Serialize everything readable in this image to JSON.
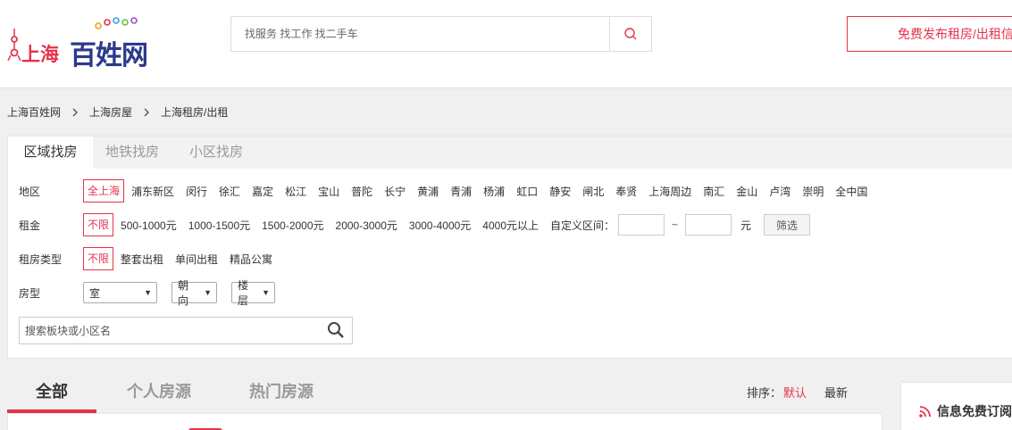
{
  "logo": {
    "city": "上海",
    "brand": "百姓网"
  },
  "search": {
    "placeholder": "找服务 找工作 找二手车"
  },
  "publish_label": "免费发布租房/出租信",
  "breadcrumb": [
    "上海百姓网",
    "上海房屋",
    "上海租房/出租"
  ],
  "filter_tabs": [
    "区域找房",
    "地铁找房",
    "小区找房"
  ],
  "filters": {
    "region": {
      "label": "地区",
      "options": [
        "全上海",
        "浦东新区",
        "闵行",
        "徐汇",
        "嘉定",
        "松江",
        "宝山",
        "普陀",
        "长宁",
        "黄浦",
        "青浦",
        "杨浦",
        "虹口",
        "静安",
        "闸北",
        "奉贤",
        "上海周边",
        "南汇",
        "金山",
        "卢湾",
        "崇明",
        "全中国"
      ]
    },
    "rent": {
      "label": "租金",
      "options": [
        "不限",
        "500-1000元",
        "1000-1500元",
        "1500-2000元",
        "2000-3000元",
        "3000-4000元",
        "4000元以上"
      ],
      "custom_label": "自定义区间：",
      "tilde": "~",
      "unit": "元",
      "button": "筛选"
    },
    "rent_type": {
      "label": "租房类型",
      "options": [
        "不限",
        "整套出租",
        "单间出租",
        "精品公寓"
      ]
    },
    "layout": {
      "label": "房型",
      "room": "室",
      "orientation": "朝向",
      "floor": "楼层"
    },
    "search_placeholder": "搜索板块或小区名"
  },
  "list_tabs": [
    "全部",
    "个人房源",
    "热门房源"
  ],
  "sort": {
    "label": "排序：",
    "default": "默认",
    "newest": "最新"
  },
  "sidebar": {
    "title": "信息免费订阅"
  },
  "colors": {
    "accent": "#e5334a",
    "brand_blue": "#2b3a8c"
  },
  "icons": [
    "tower-icon",
    "rings-icon",
    "search-icon",
    "chevron-right-icon",
    "magnifier-icon",
    "rss-icon"
  ]
}
